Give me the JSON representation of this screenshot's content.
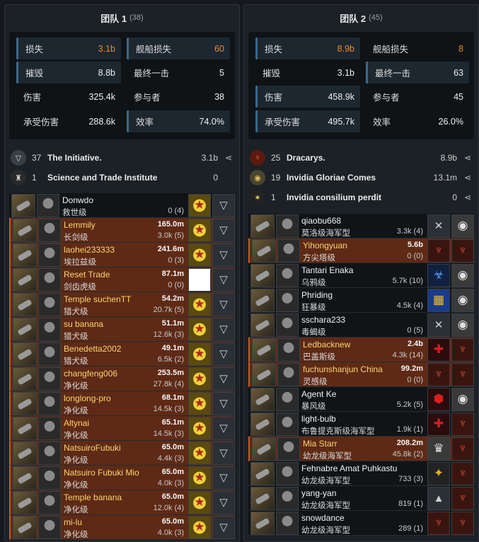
{
  "teams": [
    {
      "title": "团队 1",
      "count": "(38)",
      "stats": {
        "loss_label": "损失",
        "loss_value": "3.1b",
        "ship_loss_label": "舰船损失",
        "ship_loss_value": "60",
        "destroyed_label": "摧毁",
        "destroyed_value": "8.8b",
        "final_blow_label": "最终一击",
        "final_blow_value": "5",
        "damage_label": "伤害",
        "damage_value": "325.4k",
        "participants_label": "参与者",
        "participants_value": "38",
        "taken_label": "承受伤害",
        "taken_value": "288.6k",
        "efficiency_label": "效率",
        "efficiency_value": "74.0%"
      },
      "alliances": [
        {
          "count": "37",
          "name": "The Initiative.",
          "isk": "3.1b",
          "icon": "initiative-icon"
        },
        {
          "count": "1",
          "name": "Science and Trade Institute",
          "isk": "0",
          "icon": "sti-icon"
        }
      ],
      "members": [
        {
          "pilot": "Donwdo",
          "ship": "救世级",
          "value": "",
          "damage": "0 (4)",
          "loss": false,
          "icon1": "initiative-corp-icon",
          "icon2": "initiative-alliance-icon"
        },
        {
          "pilot": "Lemmily",
          "ship": "长剑级",
          "value": "165.0m",
          "damage": "3.0k (5)",
          "loss": true,
          "icon1": "initiative-corp-icon",
          "icon2": "initiative-alliance-icon"
        },
        {
          "pilot": "laohei233333",
          "ship": "埃拉兹级",
          "value": "241.6m",
          "damage": "0 (3)",
          "loss": true,
          "icon1": "initiative-corp-icon",
          "icon2": "initiative-alliance-icon"
        },
        {
          "pilot": "Reset Trade",
          "ship": "剑齿虎级",
          "value": "87.1m",
          "damage": "0 (0)",
          "loss": true,
          "icon1": "white-cross-icon",
          "icon2": "initiative-alliance-icon"
        },
        {
          "pilot": "Temple suchenTT",
          "ship": "猎犬级",
          "value": "54.2m",
          "damage": "20.7k (5)",
          "loss": true,
          "icon1": "initiative-corp-icon",
          "icon2": "initiative-alliance-icon"
        },
        {
          "pilot": "su banana",
          "ship": "猎犬级",
          "value": "51.1m",
          "damage": "12.6k (3)",
          "loss": true,
          "icon1": "initiative-corp-icon",
          "icon2": "initiative-alliance-icon"
        },
        {
          "pilot": "Benedetta2002",
          "ship": "猎犬级",
          "value": "49.1m",
          "damage": "6.5k (2)",
          "loss": true,
          "icon1": "initiative-corp-icon",
          "icon2": "initiative-alliance-icon"
        },
        {
          "pilot": "changfeng006",
          "ship": "净化级",
          "value": "253.5m",
          "damage": "27.8k (4)",
          "loss": true,
          "icon1": "initiative-corp-icon",
          "icon2": "initiative-alliance-icon"
        },
        {
          "pilot": "longlong-pro",
          "ship": "净化级",
          "value": "68.1m",
          "damage": "14.5k (3)",
          "loss": true,
          "icon1": "initiative-corp-icon",
          "icon2": "initiative-alliance-icon"
        },
        {
          "pilot": "Altynai",
          "ship": "净化级",
          "value": "65.1m",
          "damage": "14.5k (3)",
          "loss": true,
          "icon1": "initiative-corp-icon",
          "icon2": "initiative-alliance-icon"
        },
        {
          "pilot": "NatsuiroFubuki",
          "ship": "净化级",
          "value": "65.0m",
          "damage": "4.4k (3)",
          "loss": true,
          "icon1": "initiative-corp-icon",
          "icon2": "initiative-alliance-icon"
        },
        {
          "pilot": "Natsuiro Fubuki Mio",
          "ship": "净化级",
          "value": "65.0m",
          "damage": "4.0k (3)",
          "loss": true,
          "icon1": "initiative-corp-icon",
          "icon2": "initiative-alliance-icon"
        },
        {
          "pilot": "Temple banana",
          "ship": "净化级",
          "value": "65.0m",
          "damage": "12.0k (4)",
          "loss": true,
          "icon1": "initiative-corp-icon",
          "icon2": "initiative-alliance-icon"
        },
        {
          "pilot": "mi-lu",
          "ship": "净化级",
          "value": "65.0m",
          "damage": "4.0k (3)",
          "loss": true,
          "icon1": "initiative-corp-icon",
          "icon2": "initiative-alliance-icon"
        }
      ]
    },
    {
      "title": "团队 2",
      "count": "(45)",
      "stats": {
        "loss_label": "损失",
        "loss_value": "8.9b",
        "ship_loss_label": "舰船损失",
        "ship_loss_value": "8",
        "destroyed_label": "摧毁",
        "destroyed_value": "3.1b",
        "final_blow_label": "最终一击",
        "final_blow_value": "63",
        "damage_label": "伤害",
        "damage_value": "458.9k",
        "participants_label": "参与者",
        "participants_value": "45",
        "taken_label": "承受伤害",
        "taken_value": "495.7k",
        "efficiency_label": "效率",
        "efficiency_value": "26.0%"
      },
      "alliances": [
        {
          "count": "25",
          "name": "Dracarys.",
          "isk": "8.9b",
          "icon": "dracarys-icon"
        },
        {
          "count": "19",
          "name": "Invidia Gloriae Comes",
          "isk": "13.1m",
          "icon": "invidia-icon"
        },
        {
          "count": "1",
          "name": "Invidia consilium perdit",
          "isk": "0",
          "icon": "star-icon"
        }
      ],
      "members": [
        {
          "pilot": "qiaobu668",
          "ship": "莫洛级海军型",
          "value": "",
          "damage": "3.3k (4)",
          "loss": false,
          "icon1": "crossed-swords-icon",
          "icon2": "invidia-icon"
        },
        {
          "pilot": "Yihongyuan",
          "ship": "方尖塔级",
          "value": "5.6b",
          "damage": "0 (0)",
          "loss": true,
          "icon1": "dragon-corp-icon",
          "icon2": "dracarys-icon"
        },
        {
          "pilot": "Tantari Enaka",
          "ship": "乌鸦级",
          "value": "",
          "damage": "5.7k (10)",
          "loss": false,
          "icon1": "biohazard-icon",
          "icon2": "invidia-icon"
        },
        {
          "pilot": "Phriding",
          "ship": "狂暴级",
          "value": "",
          "damage": "4.5k (4)",
          "loss": false,
          "icon1": "checker-icon",
          "icon2": "invidia-icon"
        },
        {
          "pilot": "sschara233",
          "ship": "毒蝎级",
          "value": "",
          "damage": "0 (5)",
          "loss": false,
          "icon1": "crossed-swords-icon",
          "icon2": "invidia-icon"
        },
        {
          "pilot": "Ledbacknew",
          "ship": "巴盖斯级",
          "value": "2.4b",
          "damage": "4.3k (14)",
          "loss": true,
          "icon1": "red-cross-icon",
          "icon2": "dracarys-icon"
        },
        {
          "pilot": "fuchunshanjun China",
          "ship": "灵感级",
          "value": "99.2m",
          "damage": "0 (0)",
          "loss": true,
          "icon1": "dragon-corp-icon",
          "icon2": "dracarys-icon"
        },
        {
          "pilot": "Agent Ke",
          "ship": "暴风级",
          "value": "",
          "damage": "5.2k (5)",
          "loss": false,
          "icon1": "red-hex-icon",
          "icon2": "invidia-icon"
        },
        {
          "pilot": "light-bulb",
          "ship": "布鲁提克斯级海军型",
          "value": "",
          "damage": "1.9k (1)",
          "loss": false,
          "icon1": "red-cross-icon",
          "icon2": "dracarys-icon"
        },
        {
          "pilot": "Mia Starr",
          "ship": "幼龙级海军型",
          "value": "208.2m",
          "damage": "45.8k (2)",
          "loss": true,
          "icon1": "crest-icon",
          "icon2": "dracarys-icon"
        },
        {
          "pilot": "Fehnabre Amat Puhkastu",
          "ship": "幼龙级海军型",
          "value": "",
          "damage": "733 (3)",
          "loss": false,
          "icon1": "eagle-icon",
          "icon2": "dracarys-icon"
        },
        {
          "pilot": "yang-yan",
          "ship": "幼龙级海军型",
          "value": "",
          "damage": "819 (1)",
          "loss": false,
          "icon1": "arrow-icon",
          "icon2": "dracarys-icon"
        },
        {
          "pilot": "snowdance",
          "ship": "幼龙级海军型",
          "value": "",
          "damage": "289 (1)",
          "loss": false,
          "icon1": "dragon-corp-icon",
          "icon2": "dracarys-icon"
        }
      ]
    }
  ]
}
